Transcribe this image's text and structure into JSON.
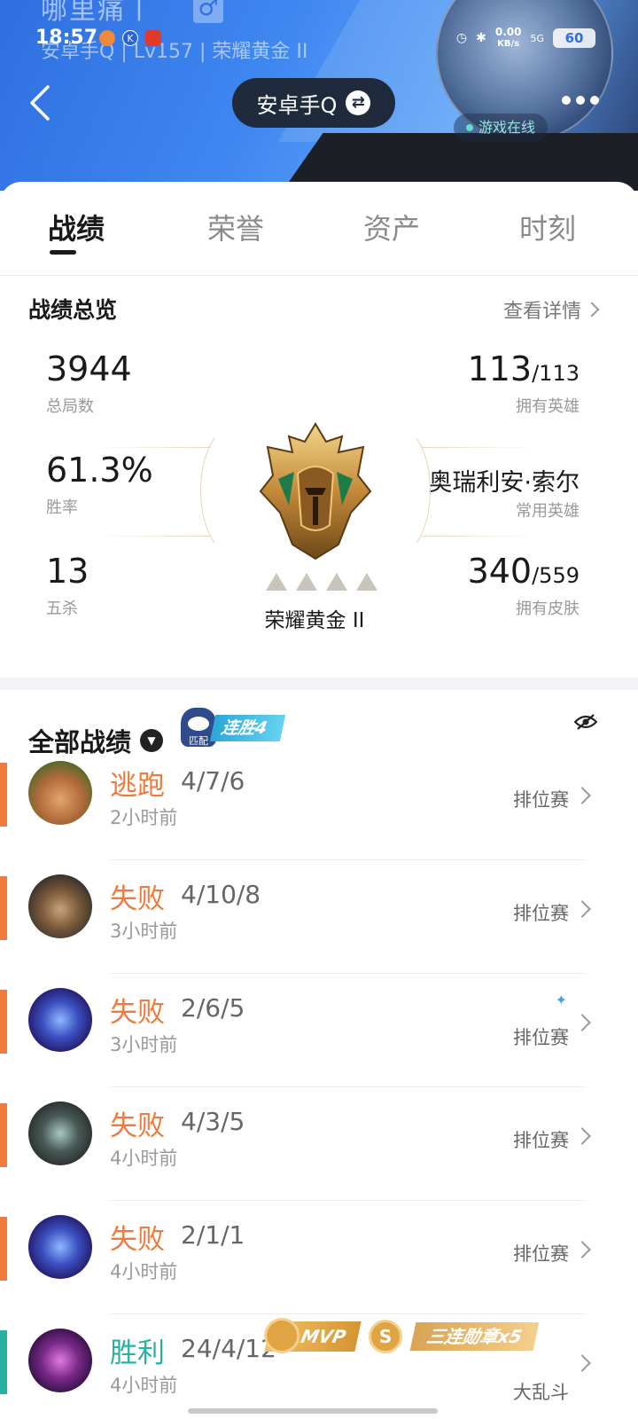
{
  "status_bar": {
    "time": "18:57",
    "net_speed": "0.00",
    "net_unit": "KB/s",
    "signal": "5G",
    "battery": "60"
  },
  "header": {
    "ghost_name": "哪里痛丨",
    "ghost_gender": "♂",
    "ghost_sub": "安卓手Q | Lv157 | 荣耀黄金 II",
    "account": "安卓手Q",
    "online_status": "游戏在线"
  },
  "tabs": [
    "战绩",
    "荣誉",
    "资产",
    "时刻"
  ],
  "overview": {
    "title": "战绩总览",
    "detail_link": "查看详情",
    "total_games": "3944",
    "total_games_label": "总局数",
    "win_rate": "61.3%",
    "win_rate_label": "胜率",
    "pentakills": "13",
    "pentakills_label": "五杀",
    "heroes_owned": "113",
    "heroes_total": "/113",
    "heroes_label": "拥有英雄",
    "common_hero": "奥瑞利安·索尔",
    "common_hero_label": "常用英雄",
    "skins_owned": "340",
    "skins_total": "/559",
    "skins_label": "拥有皮肤",
    "rank_name": "荣耀黄金 II"
  },
  "matches_header": {
    "title": "全部战绩",
    "streak_mode": "匹配",
    "streak_text": "连胜4"
  },
  "matches": [
    {
      "result": "逃跑",
      "kda": "4/7/6",
      "time": "2小时前",
      "mode": "排位赛"
    },
    {
      "result": "失败",
      "kda": "4/10/8",
      "time": "3小时前",
      "mode": "排位赛"
    },
    {
      "result": "失败",
      "kda": "2/6/5",
      "time": "3小时前",
      "mode": "排位赛"
    },
    {
      "result": "失败",
      "kda": "4/3/5",
      "time": "4小时前",
      "mode": "排位赛"
    },
    {
      "result": "失败",
      "kda": "2/1/1",
      "time": "4小时前",
      "mode": "排位赛"
    },
    {
      "result": "胜利",
      "kda": "24/4/12",
      "time": "4小时前",
      "mode": "大乱斗",
      "mvp": "MVP",
      "s_badge": "S",
      "medal": "三连勋章x5"
    }
  ],
  "colors": {
    "loss": "#ef7a3b",
    "win": "#26b1a1",
    "header_blue": "#3e86f0"
  }
}
